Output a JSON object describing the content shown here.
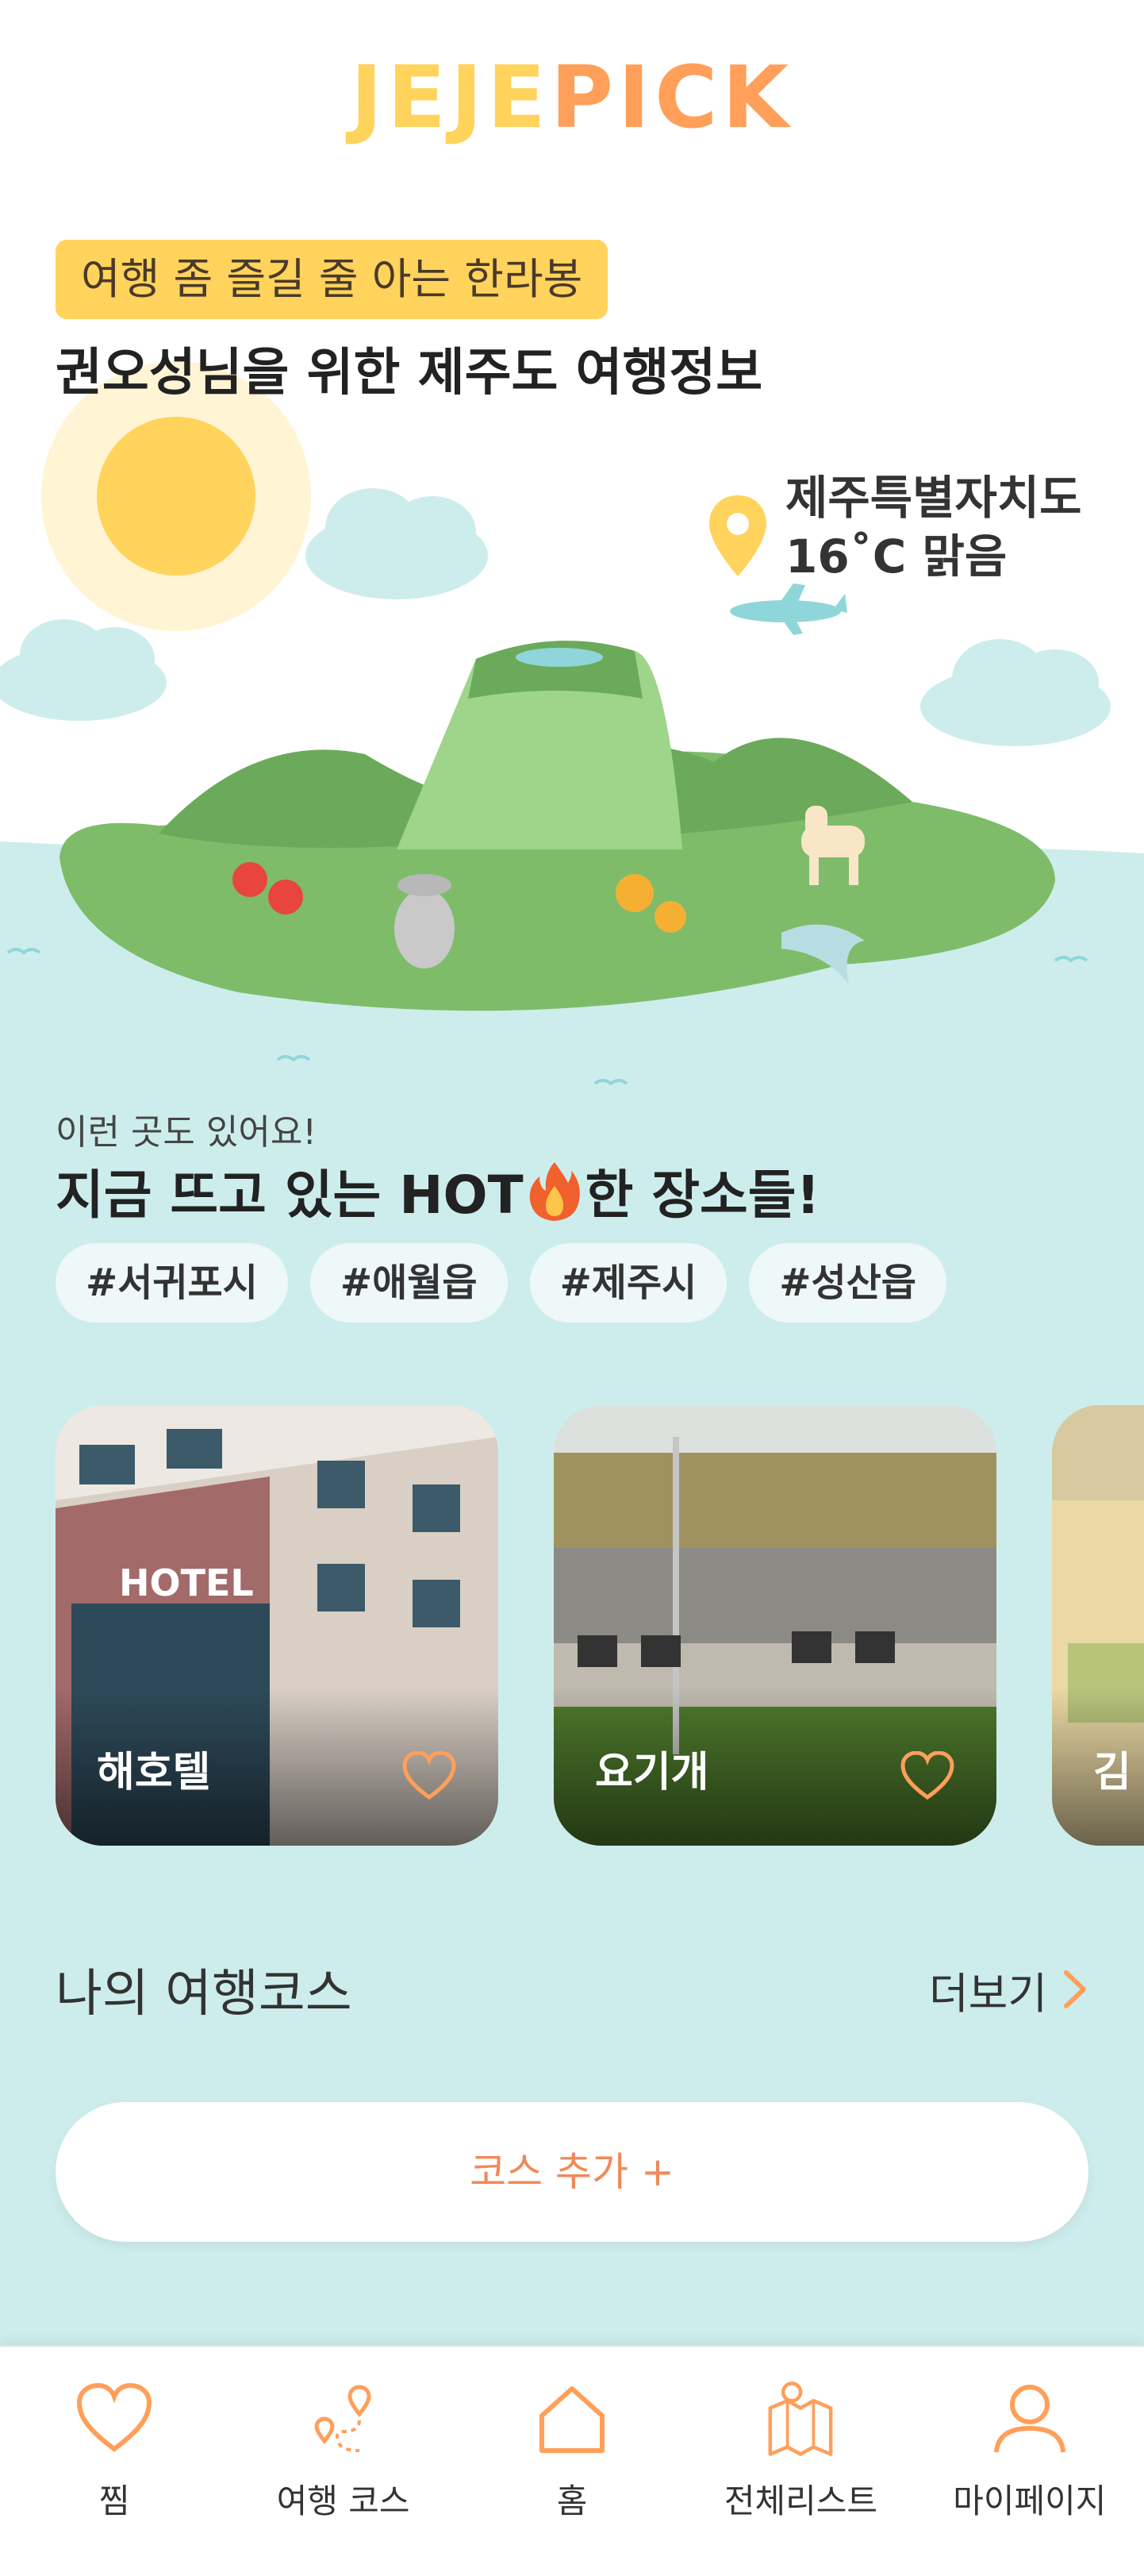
{
  "header": {
    "logo_part1": "JEJE",
    "logo_part2": "PICK"
  },
  "hero": {
    "tag": "여행 좀 즐길 줄 아는 한라봉",
    "headline": "권오성님을 위한 제주도 여행정보",
    "location": "제주특별자치도",
    "weather": "16˚C  맑음"
  },
  "hot": {
    "caption": "이런 곳도 있어요!",
    "title_before": "지금 뜨고 있는 HOT",
    "title_after": "한 장소들!",
    "chips": [
      "#서귀포시",
      "#애월읍",
      "#제주시",
      "#성산읍"
    ],
    "cards": [
      {
        "name": "해호텔"
      },
      {
        "name": "요기개"
      },
      {
        "name": "김"
      }
    ]
  },
  "course": {
    "title": "나의 여행코스",
    "more_label": "더보기",
    "add_label": "코스 추가 +"
  },
  "nav": [
    {
      "icon": "heart-icon",
      "label": "찜"
    },
    {
      "icon": "route-icon",
      "label": "여행 코스"
    },
    {
      "icon": "home-icon",
      "label": "홈"
    },
    {
      "icon": "map-icon",
      "label": "전체리스트"
    },
    {
      "icon": "user-icon",
      "label": "마이페이지"
    }
  ],
  "colors": {
    "accent_yellow": "#FFD35C",
    "accent_orange": "#FF9F5A",
    "teal_bg": "#CDEDEC"
  }
}
